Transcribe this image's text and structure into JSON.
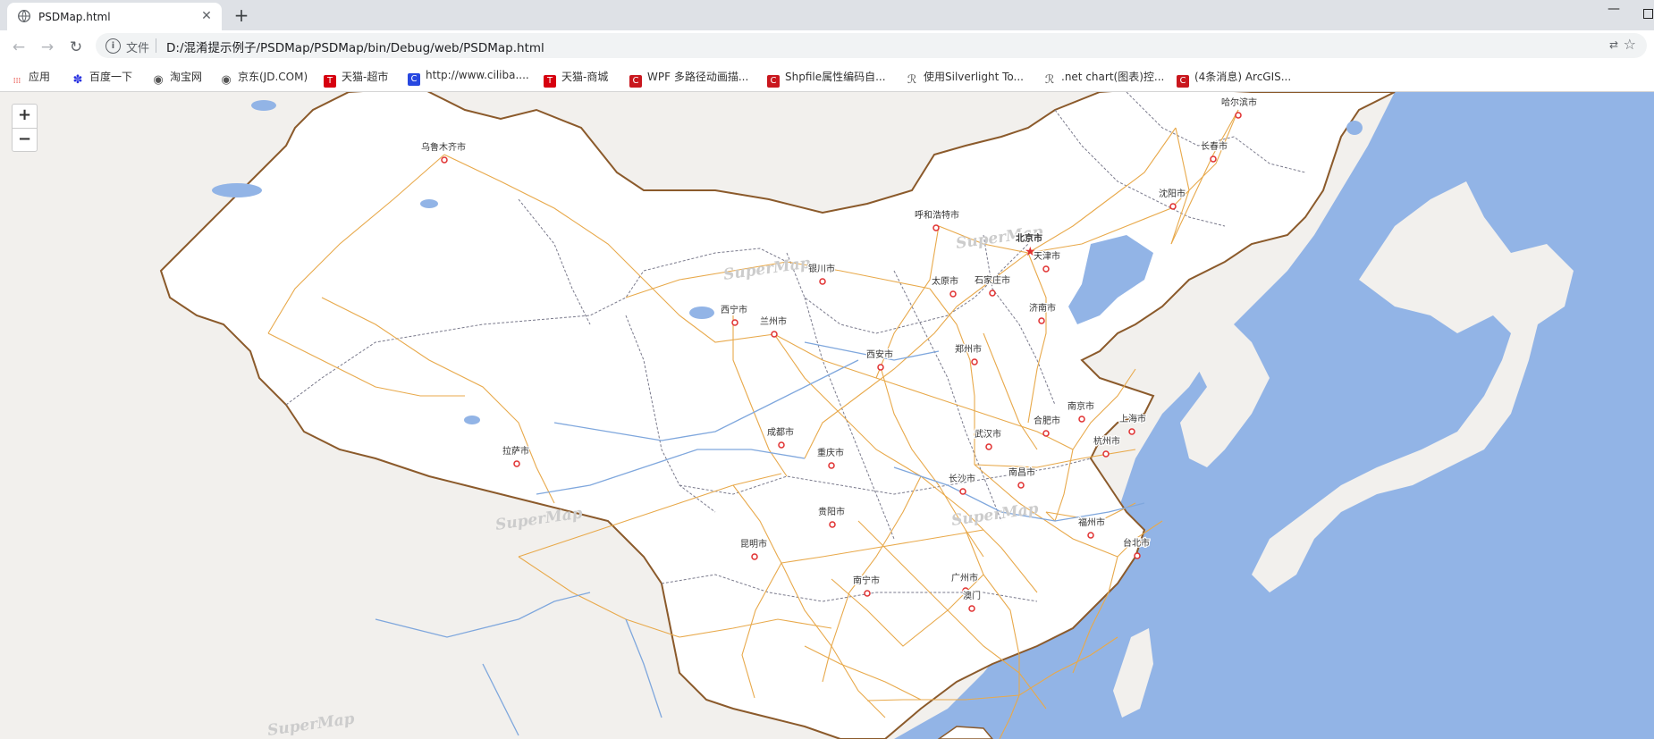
{
  "tab": {
    "title": "PSDMap.html",
    "close": "✕"
  },
  "newtab": "+",
  "window": {
    "minimize": "—"
  },
  "omnibox": {
    "scheme": "文件",
    "url": "D:/混淆提示例子/PSDMap/PSDMap/bin/Debug/web/PSDMap.html",
    "translate_icon": "translate-icon",
    "star_icon": "star-icon"
  },
  "bookmarks": [
    {
      "label": "应用",
      "icon": "apps-icon",
      "color": "#4285f4"
    },
    {
      "label": "百度一下",
      "icon": "baidu-icon",
      "color": "#2932e1"
    },
    {
      "label": "淘宝网",
      "icon": "globe-icon",
      "color": "#555555"
    },
    {
      "label": "京东(JD.COM)",
      "icon": "globe-icon",
      "color": "#555555"
    },
    {
      "label": "天猫-超市",
      "icon": "tmall-icon",
      "color": "#d6000f"
    },
    {
      "label": "http://www.ciliba....",
      "icon": "c-icon",
      "color": "#2747e0"
    },
    {
      "label": "天猫-商城",
      "icon": "tmall-icon",
      "color": "#d6000f"
    },
    {
      "label": "WPF 多路径动画描...",
      "icon": "csdn-icon",
      "color": "#c9171e"
    },
    {
      "label": "Shpfile属性编码自...",
      "icon": "csdn-icon",
      "color": "#c9171e"
    },
    {
      "label": "使用Silverlight To...",
      "icon": "script-icon",
      "color": "#555555"
    },
    {
      "label": ".net chart(图表)控...",
      "icon": "script-icon",
      "color": "#555555"
    },
    {
      "label": "(4条消息) ArcGIS...",
      "icon": "csdn-icon",
      "color": "#c9171e"
    }
  ],
  "zoom": {
    "in": "+",
    "out": "−"
  },
  "map": {
    "watermark": "SuperMap",
    "colors": {
      "sea": "#92b4e6",
      "land_china": "#ffffff",
      "land_other": "#f2f0ed",
      "border": "#8b5a2b",
      "road": "#e8a94b",
      "province": "#7a7a8c",
      "river": "#7fa7dd",
      "city": "#e03030"
    },
    "cities": [
      {
        "name": "乌鲁木齐市",
        "capital": false
      },
      {
        "name": "哈尔滨市",
        "capital": false
      },
      {
        "name": "长春市",
        "capital": false
      },
      {
        "name": "沈阳市",
        "capital": false
      },
      {
        "name": "呼和浩特市",
        "capital": false
      },
      {
        "name": "北京市",
        "capital": true
      },
      {
        "name": "天津市",
        "capital": false
      },
      {
        "name": "银川市",
        "capital": false
      },
      {
        "name": "太原市",
        "capital": false
      },
      {
        "name": "石家庄市",
        "capital": false
      },
      {
        "name": "济南市",
        "capital": false
      },
      {
        "name": "西宁市",
        "capital": false
      },
      {
        "name": "兰州市",
        "capital": false
      },
      {
        "name": "郑州市",
        "capital": false
      },
      {
        "name": "西安市",
        "capital": false
      },
      {
        "name": "南京市",
        "capital": false
      },
      {
        "name": "上海市",
        "capital": false
      },
      {
        "name": "合肥市",
        "capital": false
      },
      {
        "name": "成都市",
        "capital": false
      },
      {
        "name": "武汉市",
        "capital": false
      },
      {
        "name": "杭州市",
        "capital": false
      },
      {
        "name": "拉萨市",
        "capital": false
      },
      {
        "name": "重庆市",
        "capital": false
      },
      {
        "name": "长沙市",
        "capital": false
      },
      {
        "name": "南昌市",
        "capital": false
      },
      {
        "name": "贵阳市",
        "capital": false
      },
      {
        "name": "福州市",
        "capital": false
      },
      {
        "name": "台北市",
        "capital": false
      },
      {
        "name": "昆明市",
        "capital": false
      },
      {
        "name": "南宁市",
        "capital": false
      },
      {
        "name": "广州市",
        "capital": false
      },
      {
        "name": "澳门",
        "capital": false
      }
    ]
  }
}
